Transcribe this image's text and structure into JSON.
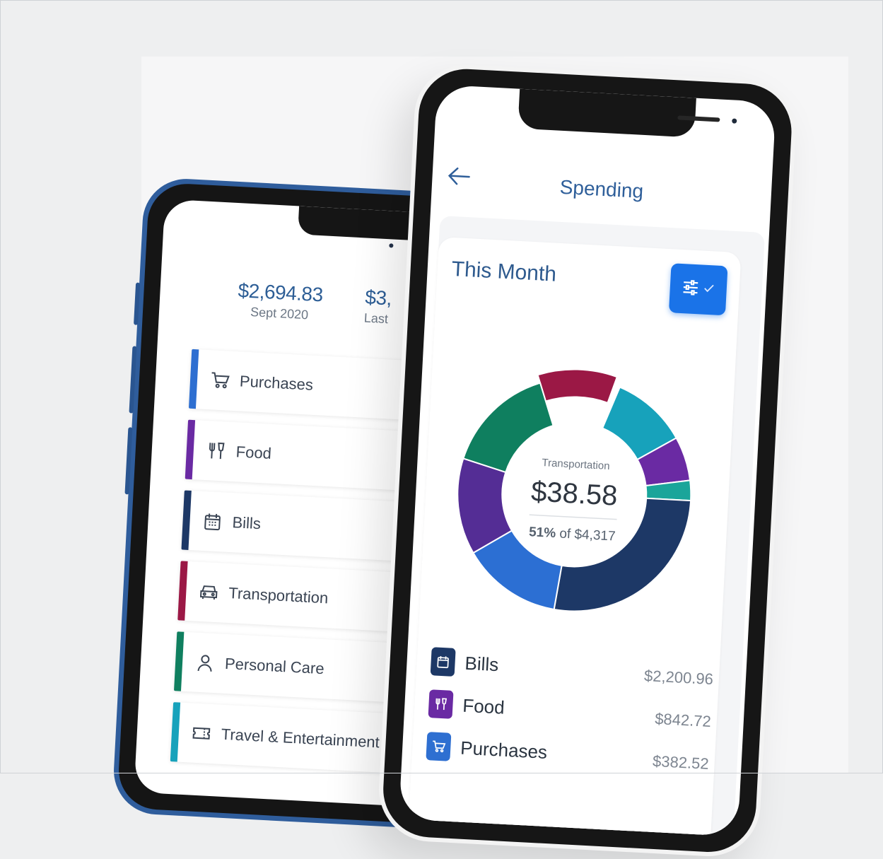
{
  "colors": {
    "purchases": "#2e6fd1",
    "food": "#6a2aa3",
    "bills": "#1d3866",
    "transportation": "#9b1845",
    "personal_care": "#0f7f5f",
    "travel": "#17a2bb",
    "teal": "#1aa59a",
    "violet": "#542d95",
    "blue": "#2c6fd3",
    "accent": "#1a73e8",
    "title": "#2f5f9a"
  },
  "back_phone": {
    "summary_current": {
      "amount": "$2,694.83",
      "period": "Sept 2020"
    },
    "summary_previous": {
      "amount": "$3,",
      "period": "Last"
    },
    "categories": [
      {
        "label": "Purchases",
        "icon": "cart-icon"
      },
      {
        "label": "Food",
        "icon": "utensils-icon"
      },
      {
        "label": "Bills",
        "icon": "calendar-icon"
      },
      {
        "label": "Transportation",
        "icon": "car-icon"
      },
      {
        "label": "Personal Care",
        "icon": "person-icon"
      },
      {
        "label": "Travel & Entertainment",
        "icon": "ticket-icon"
      }
    ]
  },
  "front_phone": {
    "header_title": "Spending",
    "card_title": "This Month",
    "chart_center": {
      "category": "Transportation",
      "amount": "$38.58",
      "percent": "51%",
      "of_text": "of $4,317"
    },
    "legend": [
      {
        "label": "Bills",
        "icon": "calendar-icon",
        "value": "$2,200.96"
      },
      {
        "label": "Food",
        "icon": "utensils-icon",
        "value": "$842.72"
      },
      {
        "label": "Purchases",
        "icon": "cart-icon",
        "value": "$382.52"
      }
    ]
  }
}
